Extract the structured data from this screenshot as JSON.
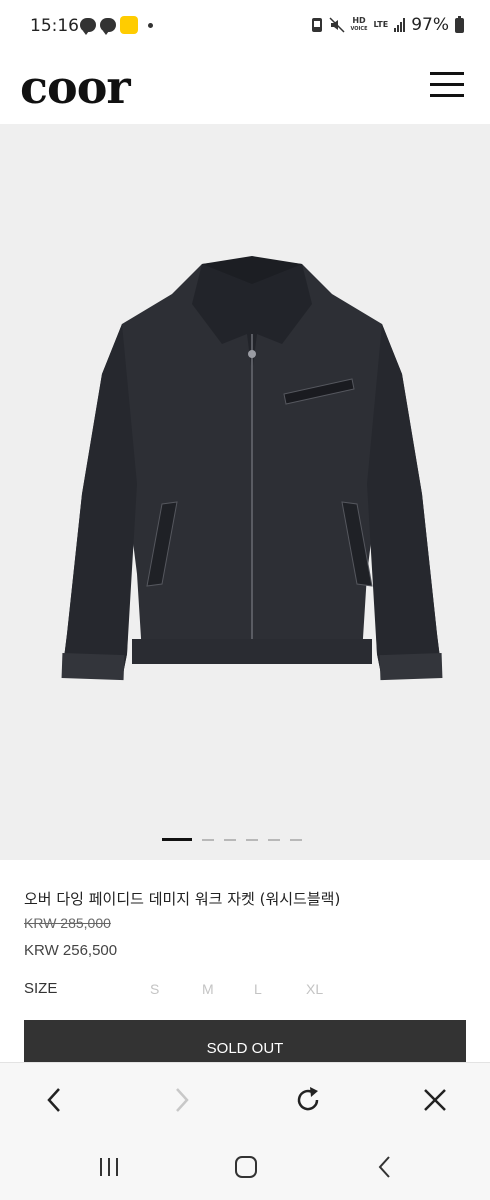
{
  "status_bar": {
    "time": "15:16",
    "network_hd": "HD",
    "network_voice": "VOICE",
    "network_lte": "LTE",
    "battery": "97%"
  },
  "header": {
    "logo": "coor"
  },
  "gallery": {
    "slide_count": 6,
    "active_slide": 1
  },
  "product": {
    "title": "오버 다잉 페이디드 데미지 워크 자켓 (워시드블랙)",
    "original_price": "KRW 285,000",
    "sale_price": "KRW 256,500",
    "size_label": "SIZE",
    "sizes": [
      "S",
      "M",
      "L",
      "XL"
    ],
    "button_label": "SOLD OUT"
  },
  "icons": {
    "menu": "hamburger-menu-icon",
    "back": "chevron-left-icon",
    "forward": "chevron-right-icon",
    "reload": "reload-icon",
    "close": "close-icon",
    "recents": "recents-icon",
    "home": "home-icon",
    "system_back": "system-back-icon"
  },
  "colors": {
    "button_bg": "#333333",
    "gallery_bg": "#efefef",
    "disabled_size": "#c4c4c4"
  }
}
